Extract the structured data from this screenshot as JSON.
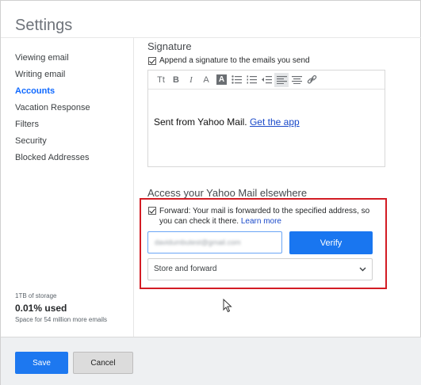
{
  "header": {
    "title": "Settings"
  },
  "sidebar": {
    "items": [
      {
        "label": "Viewing email"
      },
      {
        "label": "Writing email"
      },
      {
        "label": "Accounts"
      },
      {
        "label": "Vacation Response"
      },
      {
        "label": "Filters"
      },
      {
        "label": "Security"
      },
      {
        "label": "Blocked Addresses"
      }
    ],
    "active_index": 2,
    "storage": {
      "total": "1TB of storage",
      "used": "0.01% used",
      "space": "Space for 54 million more emails"
    }
  },
  "signature": {
    "title": "Signature",
    "checkbox_label": "Append a signature to the emails you send",
    "checked": true,
    "toolbar": {
      "text_size": "Tt",
      "bold": "B",
      "italic": "I",
      "font_color": "A",
      "highlight": "A"
    },
    "body_text": "Sent from Yahoo Mail.",
    "body_link": "Get the app"
  },
  "access": {
    "title": "Access your Yahoo Mail elsewhere",
    "forward_label": "Forward: Your mail is forwarded to the specified address, so you can check it there.",
    "learn_more": "Learn more",
    "forward_checked": true,
    "email_value": "davidumbutest@gmail.com",
    "verify_label": "Verify",
    "select_value": "Store and forward"
  },
  "footer": {
    "save_label": "Save",
    "cancel_label": "Cancel"
  },
  "colors": {
    "accent": "#1d78f0",
    "link": "#1a49c9",
    "highlight_box": "#d31c24"
  }
}
